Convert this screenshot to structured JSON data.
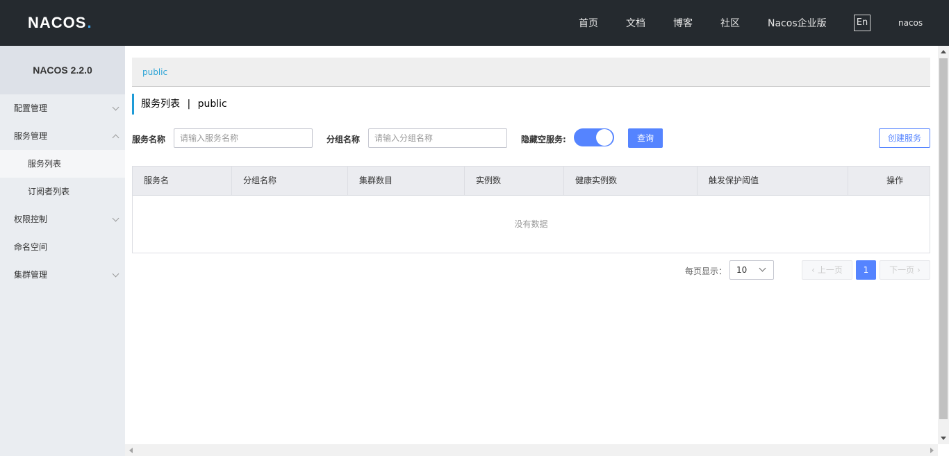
{
  "header": {
    "logo_text": "NACOS",
    "logo_dot": ".",
    "nav": [
      "首页",
      "文档",
      "博客",
      "社区",
      "Nacos企业版"
    ],
    "lang": "En",
    "user": "nacos"
  },
  "sidebar": {
    "title": "NACOS 2.2.0",
    "items": [
      {
        "label": "配置管理"
      },
      {
        "label": "服务管理"
      },
      {
        "label": "服务列表"
      },
      {
        "label": "订阅者列表"
      },
      {
        "label": "权限控制"
      },
      {
        "label": "命名空间"
      },
      {
        "label": "集群管理"
      }
    ]
  },
  "main": {
    "namespace": "public",
    "page_title": "服务列表",
    "page_sep": "|",
    "page_ns": "public",
    "form": {
      "service_name_label": "服务名称",
      "service_name_placeholder": "请输入服务名称",
      "group_name_label": "分组名称",
      "group_name_placeholder": "请输入分组名称",
      "hide_empty_label": "隐藏空服务:",
      "hide_empty_on": true,
      "query_button": "查询",
      "create_button": "创建服务"
    },
    "table": {
      "columns": [
        "服务名",
        "分组名称",
        "集群数目",
        "实例数",
        "健康实例数",
        "触发保护阈值",
        "操作"
      ],
      "empty_text": "没有数据"
    },
    "pagination": {
      "page_size_label": "每页显示：",
      "page_size": "10",
      "prev": "上一页",
      "current": "1",
      "next": "下一页"
    }
  },
  "colors": {
    "header_bg": "#252a2f",
    "primary": "#5584ff",
    "accent": "#1e9bd7"
  }
}
